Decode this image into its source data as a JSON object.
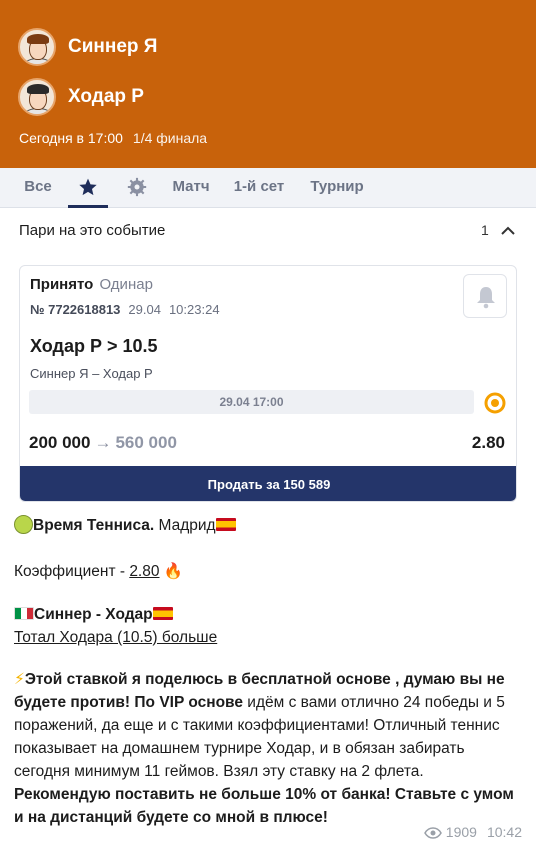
{
  "event": {
    "player1": "Синнер Я",
    "player2": "Ходар Р",
    "time": "Сегодня в 17:00",
    "stage": "1/4 финала"
  },
  "tabs": [
    {
      "label": "Все",
      "type": "text"
    },
    {
      "label": "",
      "type": "icon",
      "icon": "star-icon",
      "active": true
    },
    {
      "label": "",
      "type": "icon",
      "icon": "gear-icon"
    },
    {
      "label": "Матч",
      "type": "text"
    },
    {
      "label": "1-й сет",
      "type": "text"
    },
    {
      "label": "Турнир",
      "type": "text"
    }
  ],
  "bets": {
    "title": "Пари на это событие",
    "count": "1"
  },
  "bet_card": {
    "status": "Принято",
    "kind": "Одинар",
    "ticket_number": "№ 7722618813",
    "ticket_date": "29.04",
    "ticket_time": "10:23:24",
    "selection": "Ходар Р > 10.5",
    "matchup": "Синнер Я – Ходар Р",
    "event_datetime": "29.04 17:00",
    "stake": "200 000",
    "payout": "560 000",
    "odds": "2.80",
    "sell_label": "Продать за 150 589",
    "colors": {
      "sell_button": "#24356a",
      "header": "#c8620b"
    }
  },
  "message": {
    "line1_bold": "Время Тенниса.",
    "line1_rest": " Мадрид",
    "coef_label": "Коэффициент - ",
    "coef_value": "2.80",
    "match_line": "Синнер - Ходар",
    "total_line": "Тотал Ходара (10.5) больше",
    "p_bold1": "Этой ставкой я поделюсь в бесплатной основе , думаю вы не будете против! По VIP основе",
    "p_normal": " идём с вами отлично 24 победы и 5 поражений, да еще и с такими коэффициентами! Отличный теннис показывает на домашнем турнире Ходар, и в обязан забирать сегодня минимум 11 геймов. Взял эту ставку на 2 флета. ",
    "p_bold2": "Рекомендую поставить не больше 10% от банка! Ставьте с умом и на дистанций будете со мной в плюсе!",
    "views": "1909",
    "time": "10:42"
  }
}
